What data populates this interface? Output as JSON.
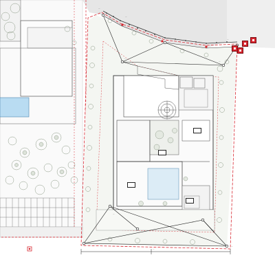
{
  "viewer": {
    "background": "#ffffff",
    "sheet_color": "#f7f7f7"
  },
  "drawing": {
    "line_color": "#333333",
    "boundary_color": "#d7262f",
    "planting_color": "#8c9a86",
    "terrain_color": "#e4e4e4",
    "pool_color": "#b9dcf2",
    "labels": {
      "road_note_top": "...",
      "road_note_mid": "...",
      "survey_note_ne": "...",
      "survey_note_nw": "...",
      "survey_note_sw": "...",
      "survey_note_se": "...",
      "survey_note_mid": "...",
      "survey_note_east": "...",
      "bottom_dimension": "...",
      "bottom_right_note": "..."
    },
    "room_tags": {
      "tag_1": "",
      "tag_2": "",
      "tag_3": "",
      "tag_4": ""
    }
  }
}
